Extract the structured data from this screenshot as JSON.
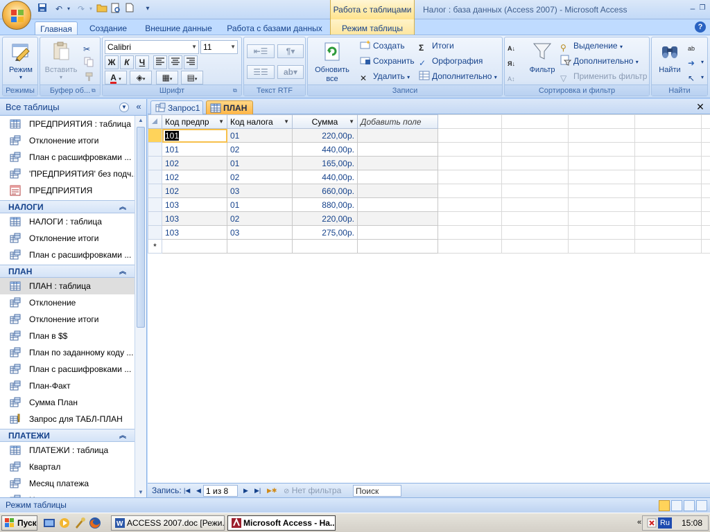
{
  "title_bar": {
    "context_tab_title": "Работа с таблицами",
    "app_title": "Налог : база данных (Access 2007) - Microsoft Access"
  },
  "ribbon_tabs": {
    "home": "Главная",
    "create": "Создание",
    "external": "Внешние данные",
    "dbtools": "Работа с базами данных",
    "datasheet": "Режим таблицы"
  },
  "ribbon": {
    "groups": {
      "views": "Режимы",
      "clipboard": "Буфер об...",
      "font": "Шрифт",
      "rtf": "Текст RTF",
      "records": "Записи",
      "sort_filter": "Сортировка и фильтр",
      "find": "Найти"
    },
    "view_btn": "Режим",
    "paste_btn": "Вставить",
    "font_name": "Calibri",
    "font_size": "11",
    "bold": "Ж",
    "italic": "К",
    "underline": "Ч",
    "refresh_btn_1": "Обновить",
    "refresh_btn_2": "все",
    "new_btn": "Создать",
    "save_btn": "Сохранить",
    "delete_btn": "Удалить",
    "totals_btn": "Итоги",
    "spelling_btn": "Орфография",
    "more_btn": "Дополнительно",
    "filter_btn": "Фильтр",
    "selection_btn": "Выделение",
    "advanced_btn": "Дополнительно",
    "apply_filter_btn": "Применить фильтр",
    "find_btn": "Найти"
  },
  "nav": {
    "title": "Все таблицы",
    "items_top": [
      {
        "label": "ПРЕДПРИЯТИЯ : таблица",
        "type": "table"
      },
      {
        "label": "Отклонение итоги",
        "type": "query"
      },
      {
        "label": "План с расшифровками ...",
        "type": "query"
      },
      {
        "label": "'ПРЕДПРИЯТИЯ' без подч...",
        "type": "query"
      },
      {
        "label": "ПРЕДПРИЯТИЯ",
        "type": "form"
      }
    ],
    "group_nalogi": "НАЛОГИ",
    "items_nalogi": [
      {
        "label": "НАЛОГИ : таблица",
        "type": "table"
      },
      {
        "label": "Отклонение итоги",
        "type": "query"
      },
      {
        "label": "План с расшифровками ...",
        "type": "query"
      }
    ],
    "group_plan": "ПЛАН",
    "items_plan": [
      {
        "label": "ПЛАН : таблица",
        "type": "table"
      },
      {
        "label": "Отклонение",
        "type": "query"
      },
      {
        "label": "Отклонение итоги",
        "type": "query"
      },
      {
        "label": "План в $$",
        "type": "query"
      },
      {
        "label": "План по заданному коду ...",
        "type": "query"
      },
      {
        "label": "План с расшифровками ...",
        "type": "query"
      },
      {
        "label": "План-Факт",
        "type": "query"
      },
      {
        "label": "Сумма План",
        "type": "query"
      },
      {
        "label": "Запрос для ТАБЛ-ПЛАН",
        "type": "action"
      }
    ],
    "group_platezhi": "ПЛАТЕЖИ",
    "items_platezhi": [
      {
        "label": "ПЛАТЕЖИ : таблица",
        "type": "table"
      },
      {
        "label": "Квартал",
        "type": "query"
      },
      {
        "label": "Месяц платежа",
        "type": "query"
      },
      {
        "label": "Наименование месяца п...",
        "type": "query"
      }
    ]
  },
  "doc_tabs": {
    "tab1": "Запрос1",
    "tab2": "ПЛАН"
  },
  "datasheet": {
    "columns": [
      "Код предпр",
      "Код налога",
      "Сумма",
      "Добавить поле"
    ],
    "rows": [
      [
        "101",
        "01",
        "220,00р."
      ],
      [
        "101",
        "02",
        "440,00р."
      ],
      [
        "102",
        "01",
        "165,00р."
      ],
      [
        "102",
        "02",
        "440,00р."
      ],
      [
        "102",
        "03",
        "660,00р."
      ],
      [
        "103",
        "01",
        "880,00р."
      ],
      [
        "103",
        "02",
        "220,00р."
      ],
      [
        "103",
        "03",
        "275,00р."
      ]
    ],
    "new_row_marker": "*"
  },
  "record_nav": {
    "label": "Запись:",
    "position": "1 из 8",
    "filter": "Нет фильтра",
    "search": "Поиск"
  },
  "status": {
    "text": "Режим таблицы"
  },
  "taskbar": {
    "start": "Пуск",
    "task1": "ACCESS 2007.doc [Режи...",
    "task2": "Microsoft Access - На...",
    "lang": "Ru",
    "clock": "15:08"
  }
}
